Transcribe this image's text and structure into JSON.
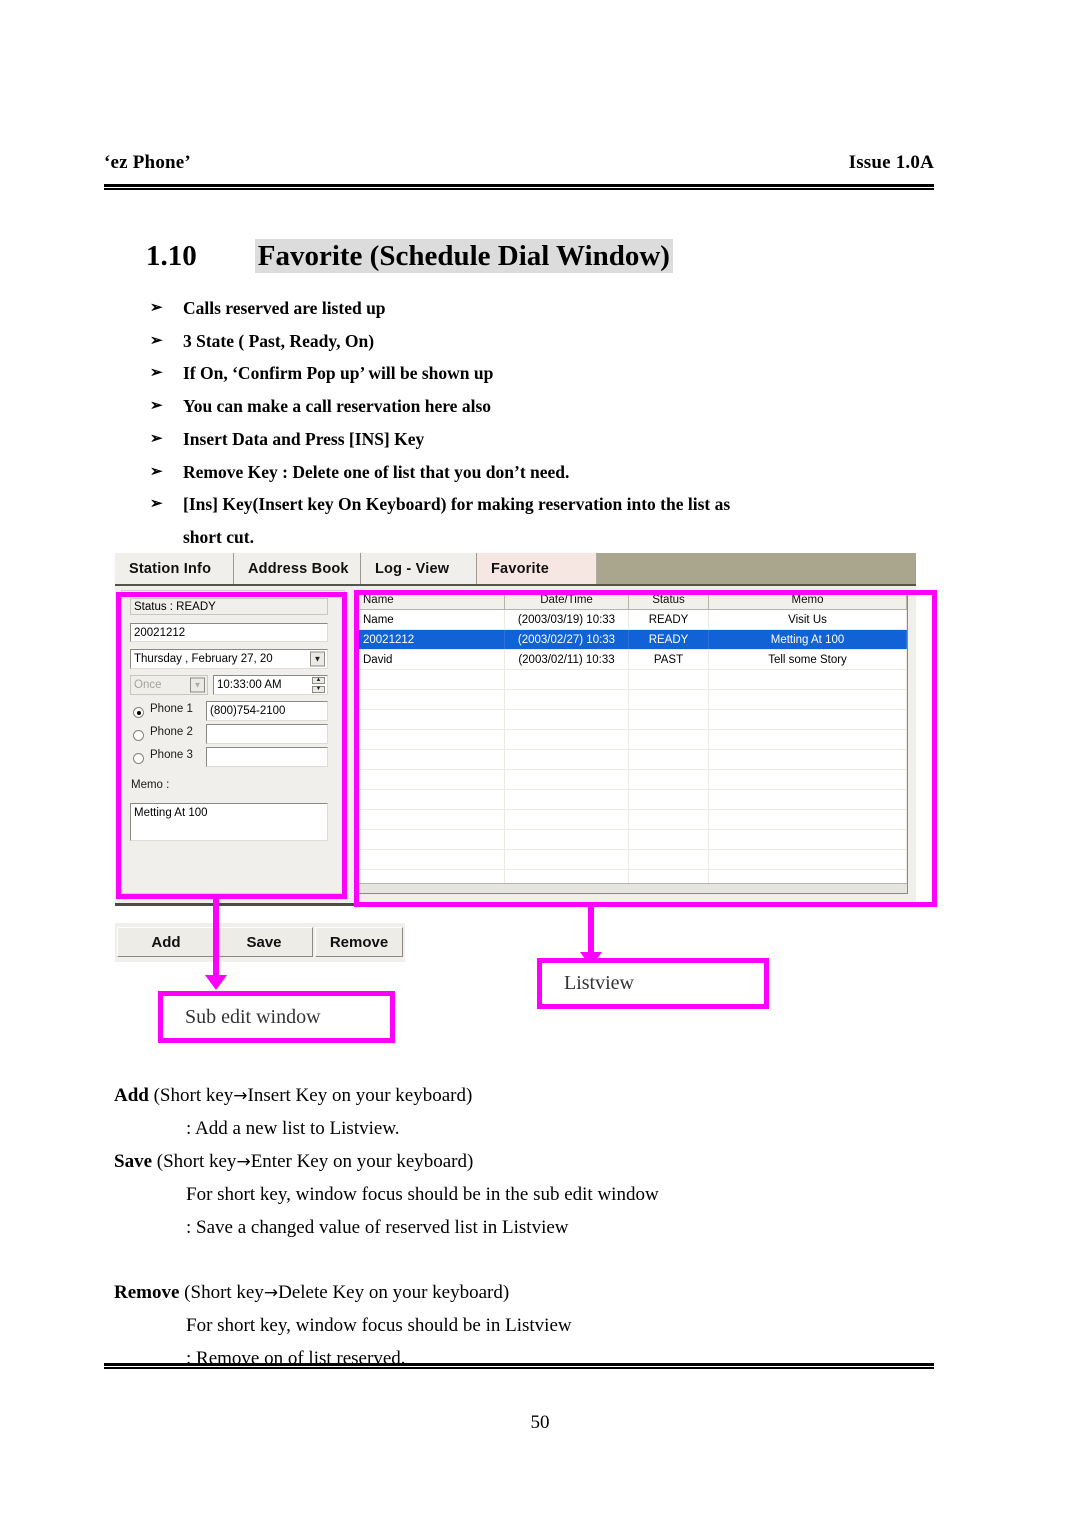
{
  "header": {
    "left": "‘ez Phone’",
    "right": "Issue 1.0A"
  },
  "section": {
    "number": "1.10",
    "title": "Favorite (Schedule Dial Window)"
  },
  "bullets": {
    "marker": "➢",
    "items": [
      "Calls reserved are listed up",
      "3 State ( Past, Ready, On)",
      "If On, ‘Confirm Pop up’ will be shown up",
      "You can make a call reservation here also",
      "Insert Data and Press [INS] Key",
      "Remove Key : Delete one of list that you don’t need.",
      "[Ins] Key(Insert key On Keyboard) for making reservation into the list as"
    ],
    "continuation": "short cut."
  },
  "screenshot": {
    "tabs": [
      {
        "label": "Station Info",
        "selected": false
      },
      {
        "label": "Address Book",
        "selected": false
      },
      {
        "label": "Log - View",
        "selected": false
      },
      {
        "label": "Favorite",
        "selected": true
      }
    ],
    "sub_edit": {
      "status_label": "Status : READY",
      "name_value": "20021212",
      "date_value": "Thursday  ,  February  27, 20",
      "repeat_value": "Once",
      "time_value": "10:33:00 AM",
      "phone1_label": "Phone 1",
      "phone1_value": "(800)754-2100",
      "phone2_label": "Phone 2",
      "phone2_value": "",
      "phone3_label": "Phone 3",
      "phone3_value": "",
      "memo_label": "Memo :",
      "memo_value": "Metting At 100"
    },
    "listview": {
      "columns": [
        "Name",
        "Date/Time",
        "Status",
        "Memo"
      ],
      "rows": [
        {
          "name": "Name",
          "datetime": "(2003/03/19) 10:33",
          "status": "READY",
          "memo": "Visit Us",
          "selected": false
        },
        {
          "name": "20021212",
          "datetime": "(2003/02/27) 10:33",
          "status": "READY",
          "memo": "Metting At 100",
          "selected": true
        },
        {
          "name": "David",
          "datetime": "(2003/02/11) 10:33",
          "status": "PAST",
          "memo": "Tell some Story",
          "selected": false
        }
      ],
      "empty_row_count": 11
    },
    "buttons": [
      {
        "label": "Add"
      },
      {
        "label": "Save"
      },
      {
        "label": "Remove"
      }
    ]
  },
  "annotations": {
    "color": "#ff00ff",
    "sub_edit_callout": "Sub edit window",
    "listview_callout": "Listview"
  },
  "descriptions": {
    "add_title_bold": "Add",
    "add_title_rest_a": " (Short key",
    "add_title_arrow": "→",
    "add_title_rest_b": "Insert Key on your keyboard)",
    "add_detail": ": Add a new list to Listview.",
    "save_title_bold": "Save",
    "save_title_rest_a": " (Short key",
    "save_title_arrow": "→",
    "save_title_rest_b": "Enter Key on your keyboard)",
    "save_detail_1": "For short key, window focus should be in the sub edit window",
    "save_detail_2": ": Save a changed value of reserved list in Listview",
    "remove_title_bold": "Remove",
    "remove_title_rest_a": " (Short key",
    "remove_title_arrow": "→",
    "remove_title_rest_b": "Delete Key on your keyboard)",
    "remove_detail_1": "For short key, window focus should be in Listview",
    "remove_detail_2": ": Remove on of list reserved."
  },
  "footer": {
    "page_number": "50"
  }
}
